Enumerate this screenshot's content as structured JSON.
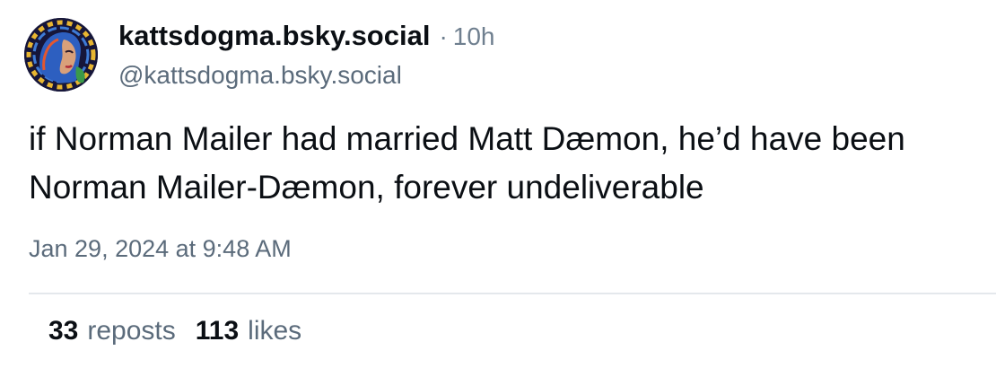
{
  "author": {
    "display_name": "kattsdogma.bsky.social",
    "separator": "·",
    "time_ago": "10h",
    "handle": "@kattsdogma.bsky.social",
    "avatar_icon": "avatar-portrait-icon"
  },
  "post": {
    "text_line_1": "if Norman Mailer had married Matt Dæmon, he’d have been",
    "text_line_2": "Norman Mailer-Dæmon, forever undeliverable",
    "timestamp": "Jan 29, 2024 at 9:48 AM"
  },
  "stats": {
    "reposts_count": "33",
    "reposts_label": "reposts",
    "likes_count": "113",
    "likes_label": "likes"
  },
  "colors": {
    "text": "#0b0f14",
    "muted": "#5b6b7b",
    "divider": "#e4e8ec",
    "avatar_bg": "#16163a"
  }
}
